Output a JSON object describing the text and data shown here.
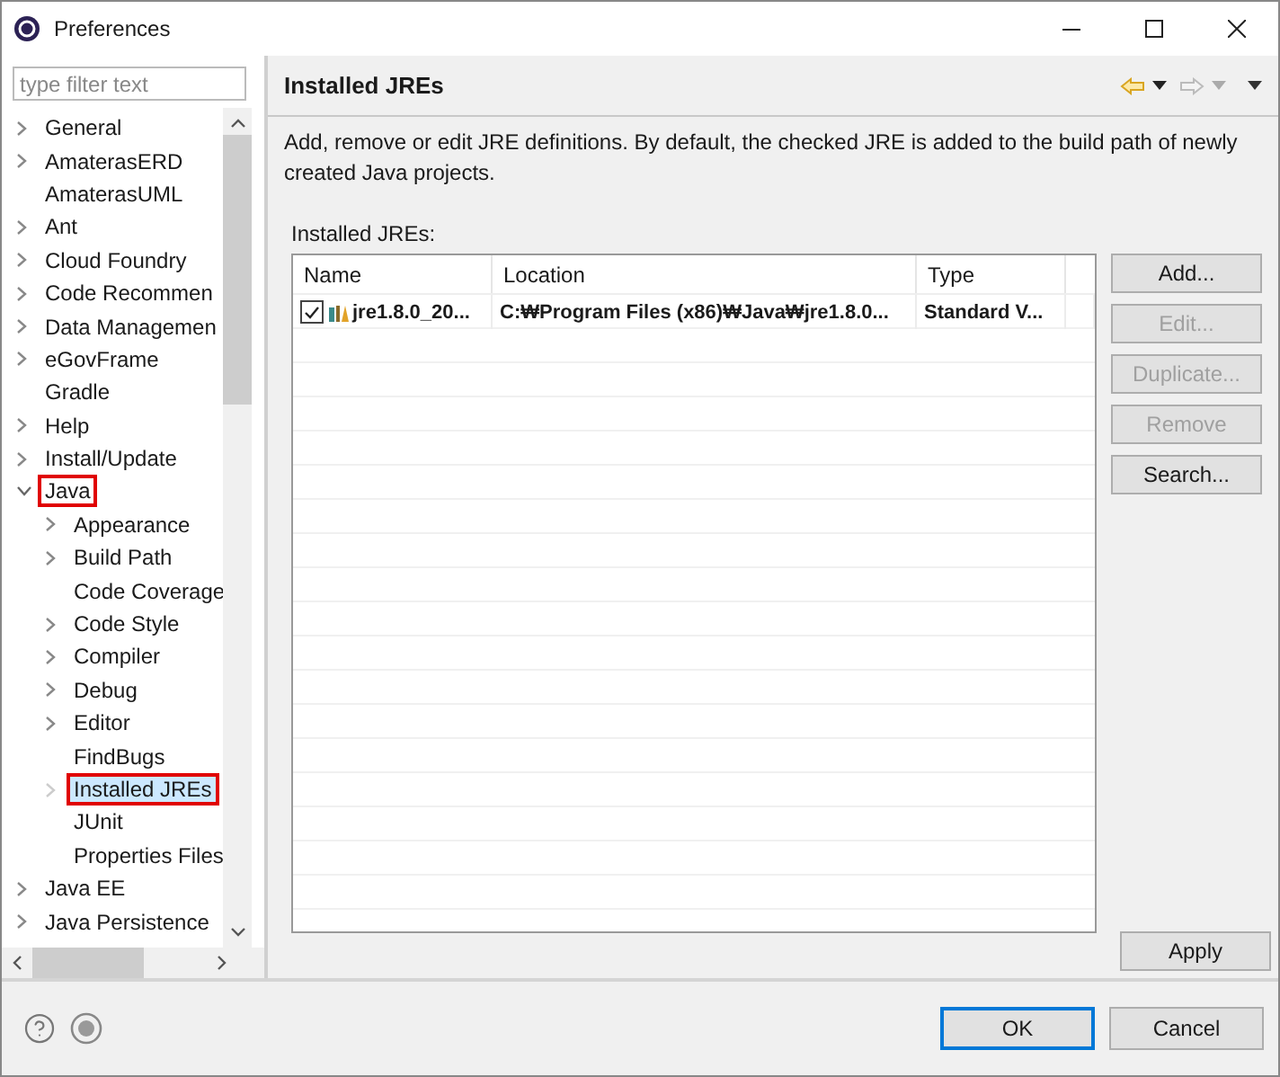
{
  "window": {
    "title": "Preferences"
  },
  "filter": {
    "placeholder": "type filter text"
  },
  "tree": [
    {
      "label": "General",
      "expandable": true,
      "expanded": false,
      "selected": false,
      "highlighted": false
    },
    {
      "label": "AmaterasERD",
      "expandable": true,
      "expanded": false,
      "selected": false,
      "highlighted": false
    },
    {
      "label": "AmaterasUML",
      "expandable": false,
      "selected": false,
      "highlighted": false
    },
    {
      "label": "Ant",
      "expandable": true,
      "expanded": false,
      "selected": false,
      "highlighted": false
    },
    {
      "label": "Cloud Foundry",
      "expandable": true,
      "expanded": false,
      "selected": false,
      "highlighted": false
    },
    {
      "label": "Code Recommen",
      "expandable": true,
      "expanded": false,
      "selected": false,
      "highlighted": false
    },
    {
      "label": "Data Managemen",
      "expandable": true,
      "expanded": false,
      "selected": false,
      "highlighted": false
    },
    {
      "label": "eGovFrame",
      "expandable": true,
      "expanded": false,
      "selected": false,
      "highlighted": false
    },
    {
      "label": "Gradle",
      "expandable": false,
      "selected": false,
      "highlighted": false
    },
    {
      "label": "Help",
      "expandable": true,
      "expanded": false,
      "selected": false,
      "highlighted": false
    },
    {
      "label": "Install/Update",
      "expandable": true,
      "expanded": false,
      "selected": false,
      "highlighted": false
    },
    {
      "label": "Java",
      "expandable": true,
      "expanded": true,
      "selected": false,
      "highlighted": true,
      "children": [
        {
          "label": "Appearance",
          "expandable": true,
          "expanded": false,
          "selected": false,
          "highlighted": false
        },
        {
          "label": "Build Path",
          "expandable": true,
          "expanded": false,
          "selected": false,
          "highlighted": false
        },
        {
          "label": "Code Coverage",
          "expandable": false,
          "selected": false,
          "highlighted": false
        },
        {
          "label": "Code Style",
          "expandable": true,
          "expanded": false,
          "selected": false,
          "highlighted": false
        },
        {
          "label": "Compiler",
          "expandable": true,
          "expanded": false,
          "selected": false,
          "highlighted": false
        },
        {
          "label": "Debug",
          "expandable": true,
          "expanded": false,
          "selected": false,
          "highlighted": false
        },
        {
          "label": "Editor",
          "expandable": true,
          "expanded": false,
          "selected": false,
          "highlighted": false
        },
        {
          "label": "FindBugs",
          "expandable": false,
          "selected": false,
          "highlighted": false
        },
        {
          "label": "Installed JREs",
          "expandable": true,
          "expanded": false,
          "selected": true,
          "highlighted": true
        },
        {
          "label": "JUnit",
          "expandable": false,
          "selected": false,
          "highlighted": false
        },
        {
          "label": "Properties Files",
          "expandable": false,
          "selected": false,
          "highlighted": false
        }
      ]
    },
    {
      "label": "Java EE",
      "expandable": true,
      "expanded": false,
      "selected": false,
      "highlighted": false
    },
    {
      "label": "Java Persistence",
      "expandable": true,
      "expanded": false,
      "selected": false,
      "highlighted": false
    }
  ],
  "page": {
    "title": "Installed JREs",
    "description": "Add, remove or edit JRE definitions. By default, the checked JRE is added to the build path of newly created Java projects.",
    "list_label": "Installed JREs:"
  },
  "table": {
    "columns": [
      "Name",
      "Location",
      "Type"
    ],
    "rows": [
      {
        "name": "jre1.8.0_20...",
        "location": "C:₩Program Files (x86)₩Java₩jre1.8.0...",
        "type": "Standard V...",
        "checked": true
      }
    ]
  },
  "side_buttons": [
    {
      "label": "Add...",
      "disabled": false
    },
    {
      "label": "Edit...",
      "disabled": true
    },
    {
      "label": "Duplicate...",
      "disabled": true
    },
    {
      "label": "Remove",
      "disabled": true
    },
    {
      "label": "Search...",
      "disabled": false
    }
  ],
  "apply": "Apply",
  "dialog_buttons": [
    {
      "label": "OK",
      "default": true
    },
    {
      "label": "Cancel",
      "default": false
    }
  ]
}
